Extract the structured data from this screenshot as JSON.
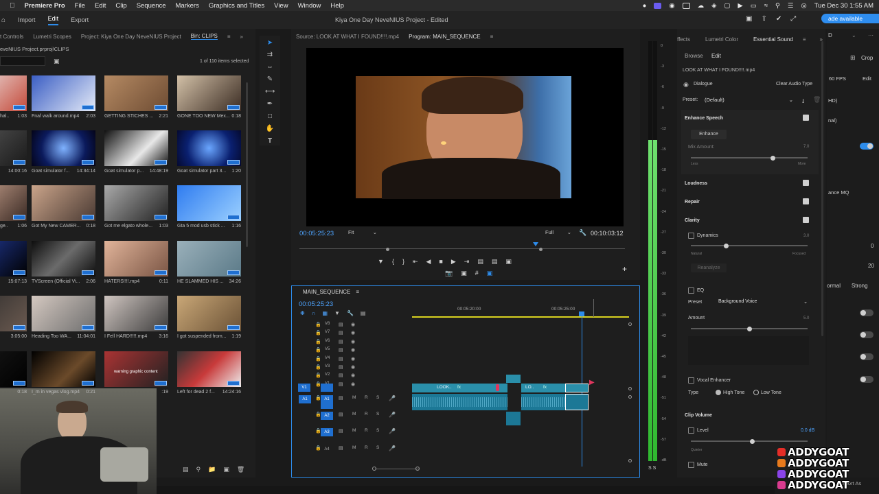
{
  "menubar": {
    "app": "Premiere Pro",
    "items": [
      "File",
      "Edit",
      "Clip",
      "Sequence",
      "Markers",
      "Graphics and Titles",
      "View",
      "Window",
      "Help"
    ],
    "clock": "Tue Dec 30  1:55 AM"
  },
  "header": {
    "workspaces": [
      "Import",
      "Edit",
      "Export"
    ],
    "project_title": "Kiya One Day NeveNIUS Project - Edited",
    "upgrade": "ade available"
  },
  "bin": {
    "tabs": [
      "t Controls",
      "Lumetri Scopes",
      "Project: Kiya One Day NeveNIUS Project",
      "Bin: CLIPS"
    ],
    "path": "eveNIUS Project.prproj\\CLIPS",
    "selected": "1 of 110 items selected",
    "clips": [
      {
        "name": "hal..",
        "dur": "1:03"
      },
      {
        "name": "Fnaf walk around.mp4",
        "dur": "2:03"
      },
      {
        "name": "GETTING STICHES ...",
        "dur": "2:21"
      },
      {
        "name": "GONE TOO NEW Mex...",
        "dur": "0:18"
      },
      {
        "name": "",
        "dur": "14:00:16"
      },
      {
        "name": "Goat simulator f...",
        "dur": "14:34:14"
      },
      {
        "name": "Goat simulator p...",
        "dur": "14:48:19"
      },
      {
        "name": "Goat simulator part 3...",
        "dur": "1:20"
      },
      {
        "name": "ge..",
        "dur": "1:06"
      },
      {
        "name": "Got My New CAMER...",
        "dur": "0:18"
      },
      {
        "name": "Got me elgato whole...",
        "dur": "1:03"
      },
      {
        "name": "Gta 5 mod usb stick ...",
        "dur": "1:16"
      },
      {
        "name": "",
        "dur": "15:07:13"
      },
      {
        "name": "TVScreen (Official Vi...",
        "dur": "2:06"
      },
      {
        "name": "HATERS!!!!.mp4",
        "dur": "0:11"
      },
      {
        "name": "HE SLAMMED HIS ...",
        "dur": "34:26"
      },
      {
        "name": "",
        "dur": "3:05:00"
      },
      {
        "name": "Heading Too WA...",
        "dur": "11:04:01"
      },
      {
        "name": "I Fell HARD!!!!!.mp4",
        "dur": "3:16"
      },
      {
        "name": "I got suspended from...",
        "dur": "1:19"
      },
      {
        "name": "",
        "dur": "0:18"
      },
      {
        "name": "I_m in vegas vlog.mp4",
        "dur": "0:21"
      },
      {
        "name": "",
        "dur": ":19"
      },
      {
        "name": "Left for dead 2 f...",
        "dur": "14:24:16"
      }
    ],
    "warning_text": "warning graphic content"
  },
  "source": {
    "tab": "Source: LOOK AT WHAT I FOUND!!!!.mp4",
    "program_tab": "Program: MAIN_SEQUENCE",
    "timecode": "00:05:25:23",
    "fit": "Fit",
    "full": "Full",
    "duration": "00:10:03:12"
  },
  "timeline": {
    "tab": "MAIN_SEQUENCE",
    "timecode": "00:05:25:23",
    "ruler": [
      "00:05:20:00",
      "00:05:25:00"
    ],
    "video_tracks": [
      "V8",
      "V7",
      "V6",
      "V5",
      "V4",
      "V3",
      "V2",
      "V1"
    ],
    "audio_tracks": [
      "A1",
      "A2",
      "A3",
      "A4"
    ],
    "track_ctl": [
      "M",
      "S"
    ],
    "clip1": "LOOK..",
    "clip2": "LO..",
    "fx": "fx",
    "v1": "V1",
    "a1": "A1"
  },
  "meter_scale": [
    "0",
    "-3",
    "-6",
    "-9",
    "-12",
    "-15",
    "-18",
    "-21",
    "-24",
    "-27",
    "-30",
    "-33",
    "-36",
    "-39",
    "-42",
    "-45",
    "-48",
    "-51",
    "-54",
    "-57",
    "-dB"
  ],
  "meter_ss": "S  S",
  "essential_sound": {
    "tabs": [
      "ffects",
      "Lumetri Color",
      "Essential Sound"
    ],
    "subtabs": [
      "Browse",
      "Edit"
    ],
    "file": "LOOK AT WHAT I FOUND!!!!.mp4",
    "type": "Dialogue",
    "clear": "Clear Audio Type",
    "preset_label": "Preset:",
    "preset_value": "(Default)",
    "enhance_speech": "Enhance Speech",
    "enhance_btn": "Enhance",
    "mix_amount": "Mix Amount:",
    "mix_less": "Less",
    "mix_more": "More",
    "mix_value": "7.0",
    "loudness": "Loudness",
    "repair": "Repair",
    "clarity": "Clarity",
    "dynamics": "Dynamics",
    "dynamics_value": "3.0",
    "natural": "Natural",
    "focused": "Focused",
    "reanalyze": "Reanalyze",
    "eq": "EQ",
    "eq_preset_label": "Preset",
    "eq_preset": "Background Voice",
    "amount": "Amount",
    "amount_value": "5.0",
    "vocal_enhancer": "Vocal Enhancer",
    "type_label": "Type",
    "high_tone": "High Tone",
    "low_tone": "Low Tone",
    "clip_volume": "Clip Volume",
    "level": "Level",
    "level_value": "0.0 dB",
    "quieter": "Quieter",
    "mute": "Mute"
  },
  "right_panel": {
    "crop": "Crop",
    "fps": "60 FPS",
    "edit": "Edit",
    "hd": "HD)",
    "nal": "nal)",
    "mq": "ance MQ",
    "v0": "0",
    "v20": "20",
    "normal": "ormal",
    "strong": "Strong",
    "export": "Export As"
  },
  "watermark": [
    "ADDYGOAT",
    "ADDYGOAT",
    "ADDYGOAT",
    "ADDYGOAT"
  ],
  "colors": {
    "accent": "#2d8ceb",
    "meter": "#3ecf3e",
    "clip": "#1f7f9e",
    "upgrade": "#2f8ef0"
  }
}
